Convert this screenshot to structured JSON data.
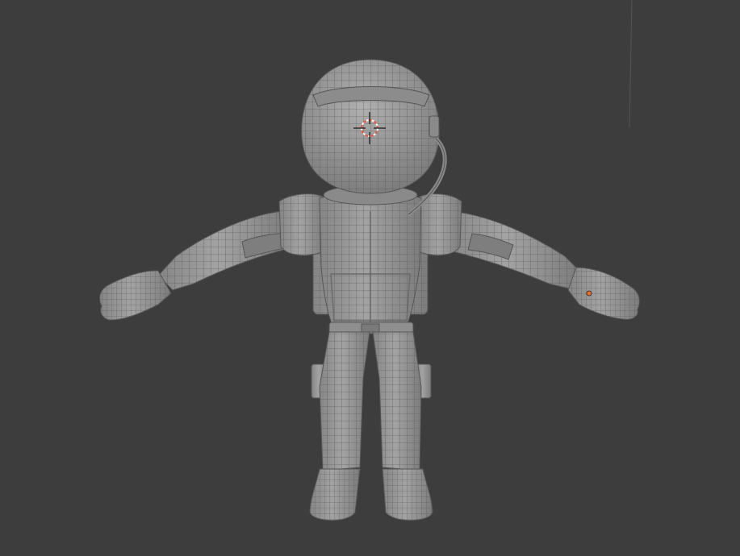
{
  "viewport": {
    "background": "#3d3d3d",
    "mesh_color": "#9a9a9a",
    "mesh_shadow": "#6e6e6e",
    "wire_color": "#4a4a4a",
    "cursor_color": "#e0573f",
    "origin_color": "#e8702a"
  },
  "scene": {
    "model": "astronaut-character-tpose",
    "icons": {
      "cursor": "3d-cursor-icon",
      "origin": "object-origin-dot-icon"
    }
  }
}
